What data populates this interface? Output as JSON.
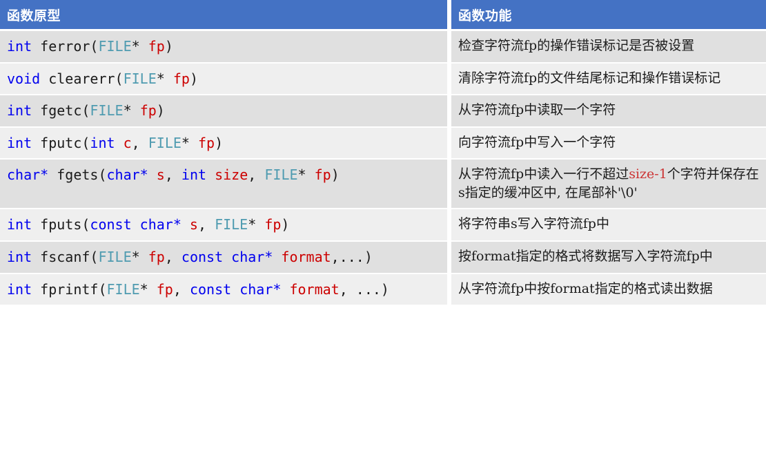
{
  "table": {
    "header": {
      "prototype_label": "函数原型",
      "function_label": "函数功能"
    },
    "colors": {
      "header_background": "#4472c4",
      "header_text": "#ffffff",
      "row_shade_dark": "#e0e0e0",
      "row_shade_light": "#efefef",
      "keyword": "#0000ee",
      "type_file": "#4f9bb0",
      "identifier": "#cc0000",
      "punctuation": "#1a1a1a",
      "description_code": "#cc3333"
    },
    "rows": [
      {
        "prototype_text": "int ferror(FILE* fp)",
        "prototype_tokens": [
          {
            "t": "int",
            "c": "kw"
          },
          {
            "t": " ferror(",
            "c": "pun"
          },
          {
            "t": "FILE",
            "c": "typ"
          },
          {
            "t": "* ",
            "c": "pun"
          },
          {
            "t": "fp",
            "c": "var"
          },
          {
            "t": ")",
            "c": "pun"
          }
        ],
        "description_text": "检查字符流fp的操作错误标记是否被设置",
        "description_parts": [
          {
            "t": "检查字符流fp的操作错误标记是否被设置",
            "c": "plain"
          }
        ]
      },
      {
        "prototype_text": "void clearerr(FILE* fp)",
        "prototype_tokens": [
          {
            "t": "void",
            "c": "kw"
          },
          {
            "t": " clearerr(",
            "c": "pun"
          },
          {
            "t": "FILE",
            "c": "typ"
          },
          {
            "t": "* ",
            "c": "pun"
          },
          {
            "t": "fp",
            "c": "var"
          },
          {
            "t": ")",
            "c": "pun"
          }
        ],
        "description_text": "清除字符流fp的文件结尾标记和操作错误标记",
        "description_parts": [
          {
            "t": "清除字符流fp的文件结尾标记和操作错误标记",
            "c": "plain"
          }
        ]
      },
      {
        "prototype_text": "int fgetc(FILE* fp)",
        "prototype_tokens": [
          {
            "t": "int",
            "c": "kw"
          },
          {
            "t": " fgetc(",
            "c": "pun"
          },
          {
            "t": "FILE",
            "c": "typ"
          },
          {
            "t": "* ",
            "c": "pun"
          },
          {
            "t": "fp",
            "c": "var"
          },
          {
            "t": ")",
            "c": "pun"
          }
        ],
        "description_text": "从字符流fp中读取一个字符",
        "description_parts": [
          {
            "t": "从字符流fp中读取一个字符",
            "c": "plain"
          }
        ]
      },
      {
        "prototype_text": "int fputc(int c, FILE* fp)",
        "prototype_tokens": [
          {
            "t": "int",
            "c": "kw"
          },
          {
            "t": " fputc(",
            "c": "pun"
          },
          {
            "t": "int",
            "c": "kw"
          },
          {
            "t": " ",
            "c": "pun"
          },
          {
            "t": "c",
            "c": "var"
          },
          {
            "t": ", ",
            "c": "pun"
          },
          {
            "t": "FILE",
            "c": "typ"
          },
          {
            "t": "* ",
            "c": "pun"
          },
          {
            "t": "fp",
            "c": "var"
          },
          {
            "t": ")",
            "c": "pun"
          }
        ],
        "description_text": "向字符流fp中写入一个字符",
        "description_parts": [
          {
            "t": "向字符流fp中写入一个字符",
            "c": "plain"
          }
        ]
      },
      {
        "prototype_text": "char* fgets(char* s, int size, FILE* fp)",
        "prototype_tokens": [
          {
            "t": "char*",
            "c": "kw"
          },
          {
            "t": " fgets(",
            "c": "pun"
          },
          {
            "t": "char*",
            "c": "kw"
          },
          {
            "t": " ",
            "c": "pun"
          },
          {
            "t": "s",
            "c": "var"
          },
          {
            "t": ", ",
            "c": "pun"
          },
          {
            "t": "int",
            "c": "kw"
          },
          {
            "t": " ",
            "c": "pun"
          },
          {
            "t": "size",
            "c": "var"
          },
          {
            "t": ", ",
            "c": "pun"
          },
          {
            "t": "FILE",
            "c": "typ"
          },
          {
            "t": "* ",
            "c": "pun"
          },
          {
            "t": "fp",
            "c": "var"
          },
          {
            "t": ")",
            "c": "pun"
          }
        ],
        "description_text": "从字符流fp中读入一行不超过size-1个字符并保存在s指定的缓冲区中, 在尾部补'\\0'",
        "description_parts": [
          {
            "t": "从字符流fp中读入一行不超过",
            "c": "plain"
          },
          {
            "t": "size-1",
            "c": "code"
          },
          {
            "t": "个字符并保存在s指定的缓冲区中, 在尾部补'\\0'",
            "c": "plain"
          }
        ]
      },
      {
        "prototype_text": "int fputs(const char* s, FILE* fp)",
        "prototype_tokens": [
          {
            "t": "int",
            "c": "kw"
          },
          {
            "t": " fputs(",
            "c": "pun"
          },
          {
            "t": "const char*",
            "c": "kw"
          },
          {
            "t": " ",
            "c": "pun"
          },
          {
            "t": "s",
            "c": "var"
          },
          {
            "t": ", ",
            "c": "pun"
          },
          {
            "t": "FILE",
            "c": "typ"
          },
          {
            "t": "* ",
            "c": "pun"
          },
          {
            "t": "fp",
            "c": "var"
          },
          {
            "t": ")",
            "c": "pun"
          }
        ],
        "description_text": "将字符串s写入字符流fp中",
        "description_parts": [
          {
            "t": "将字符串s写入字符流fp中",
            "c": "plain"
          }
        ]
      },
      {
        "prototype_text": "int fscanf(FILE* fp, const char* format,...)",
        "prototype_tokens": [
          {
            "t": "int",
            "c": "kw"
          },
          {
            "t": " fscanf(",
            "c": "pun"
          },
          {
            "t": "FILE",
            "c": "typ"
          },
          {
            "t": "* ",
            "c": "pun"
          },
          {
            "t": "fp",
            "c": "var"
          },
          {
            "t": ", ",
            "c": "pun"
          },
          {
            "t": "const char*",
            "c": "kw"
          },
          {
            "t": " ",
            "c": "pun"
          },
          {
            "t": "format",
            "c": "var"
          },
          {
            "t": ",...)",
            "c": "pun"
          }
        ],
        "description_text": "按format指定的格式将数据写入字符流fp中",
        "description_parts": [
          {
            "t": "按format指定的格式将数据写入字符流fp中",
            "c": "plain"
          }
        ]
      },
      {
        "prototype_text": "int fprintf(FILE* fp, const char* format, ...)",
        "prototype_tokens": [
          {
            "t": "int",
            "c": "kw"
          },
          {
            "t": " fprintf(",
            "c": "pun"
          },
          {
            "t": "FILE",
            "c": "typ"
          },
          {
            "t": "* ",
            "c": "pun"
          },
          {
            "t": "fp",
            "c": "var"
          },
          {
            "t": ", ",
            "c": "pun"
          },
          {
            "t": "const char*",
            "c": "kw"
          },
          {
            "t": " ",
            "c": "pun"
          },
          {
            "t": "format",
            "c": "var"
          },
          {
            "t": ", ...)",
            "c": "pun"
          }
        ],
        "description_text": "从字符流fp中按format指定的格式读出数据",
        "description_parts": [
          {
            "t": "从字符流fp中按format指定的格式读出数据",
            "c": "plain"
          }
        ]
      }
    ]
  }
}
